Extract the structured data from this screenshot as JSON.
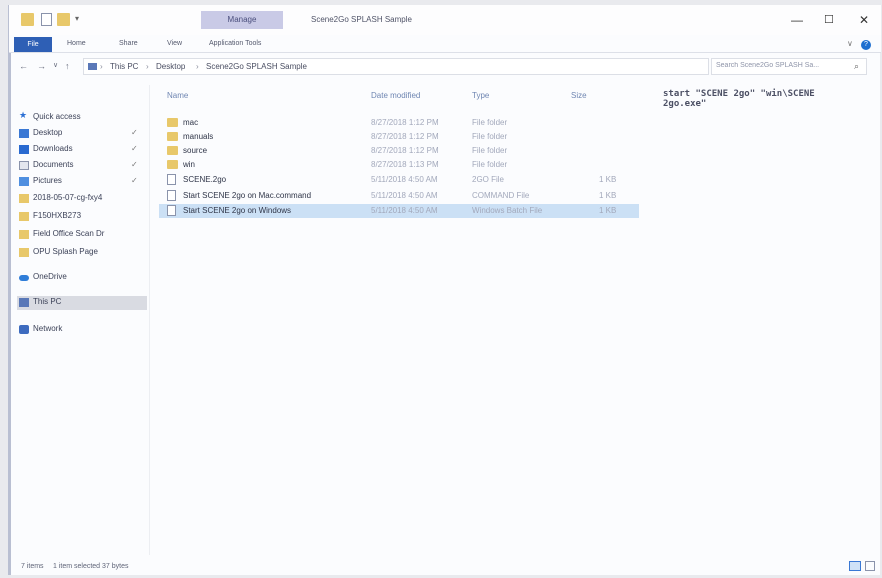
{
  "window": {
    "manage_tab": "Manage",
    "title": "Scene2Go SPLASH Sample",
    "minimize": "—",
    "maximize": "☐",
    "close": "✕"
  },
  "ribbon": {
    "file": "File",
    "home": "Home",
    "share": "Share",
    "view": "View",
    "application_tools": "Application Tools",
    "help": "?"
  },
  "address": {
    "back": "←",
    "forward": "→",
    "recent": "∨",
    "up": "↑",
    "crumbs": [
      "This PC",
      "Desktop",
      "Scene2Go SPLASH Sample"
    ],
    "separator": "›",
    "refresh": "↻",
    "search_placeholder": "Search Scene2Go SPLASH Sa...",
    "search_icon": "⌕"
  },
  "navpane": {
    "quick_access": "Quick access",
    "pin": "✓",
    "items": [
      {
        "label": "Desktop",
        "icon": "desktop-icon",
        "pinned": true
      },
      {
        "label": "Downloads",
        "icon": "download-icon",
        "pinned": true
      },
      {
        "label": "Documents",
        "icon": "documents-icon",
        "pinned": true
      },
      {
        "label": "Pictures",
        "icon": "pictures-icon",
        "pinned": true
      },
      {
        "label": "2018-05-07-cg-fxy4",
        "icon": "folder-icon",
        "pinned": false
      },
      {
        "label": "F150HXB273",
        "icon": "folder-icon",
        "pinned": false
      },
      {
        "label": "Field Office Scan Dr",
        "icon": "folder-icon",
        "pinned": false
      },
      {
        "label": "OPU Splash Page",
        "icon": "folder-icon",
        "pinned": false
      }
    ],
    "onedrive": "OneDrive",
    "this_pc": "This PC",
    "network": "Network"
  },
  "columns": {
    "name": "Name",
    "date_modified": "Date modified",
    "type": "Type",
    "size": "Size"
  },
  "files": [
    {
      "name": "mac",
      "date": "8/27/2018 1:12 PM",
      "type": "File folder",
      "size": "",
      "kind": "folder"
    },
    {
      "name": "manuals",
      "date": "8/27/2018 1:12 PM",
      "type": "File folder",
      "size": "",
      "kind": "folder"
    },
    {
      "name": "source",
      "date": "8/27/2018 1:12 PM",
      "type": "File folder",
      "size": "",
      "kind": "folder"
    },
    {
      "name": "win",
      "date": "8/27/2018 1:13 PM",
      "type": "File folder",
      "size": "",
      "kind": "folder"
    },
    {
      "name": "SCENE.2go",
      "date": "5/11/2018 4:50 AM",
      "type": "2GO File",
      "size": "1 KB",
      "kind": "file"
    },
    {
      "name": "Start SCENE 2go on Mac.command",
      "date": "5/11/2018 4:50 AM",
      "type": "COMMAND File",
      "size": "1 KB",
      "kind": "file"
    },
    {
      "name": "Start SCENE 2go on Windows",
      "date": "5/11/2018 4:50 AM",
      "type": "Windows Batch File",
      "size": "1 KB",
      "kind": "file",
      "selected": true
    }
  ],
  "snippet": "start \"SCENE 2go\" \"win\\SCENE\n2go.exe\"",
  "status": {
    "items": "7 items",
    "selected": "1 item selected  37 bytes"
  },
  "colors": {
    "file_tab": "#2e5fb5",
    "manage_tab": "#c9cae6",
    "selection": "#cbe0f5",
    "folder": "#e8c86a"
  }
}
